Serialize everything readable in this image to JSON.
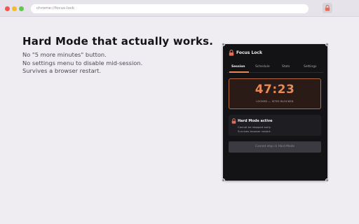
{
  "browser": {
    "url": "chrome://focus-lock",
    "window_controls": [
      "close",
      "minimize",
      "maximize"
    ],
    "extension_icon": "lock-icon"
  },
  "hero": {
    "headline": "Hard Mode that actually works.",
    "lines": [
      "No \"5 more minutes\" button.",
      "No settings menu to disable mid-session.",
      "Survives a browser restart."
    ]
  },
  "popup": {
    "title": "Focus Lock",
    "tabs": [
      {
        "label": "Session",
        "active": true
      },
      {
        "label": "Schedule",
        "active": false
      },
      {
        "label": "Stats",
        "active": false
      },
      {
        "label": "Settings",
        "active": false
      }
    ],
    "timer": {
      "value": "47:23",
      "status": "LOCKED — SITES BLOCKED"
    },
    "hard_mode": {
      "title": "Hard Mode active",
      "lines": [
        "Cannot be stopped early.",
        "Survives browser restart."
      ]
    },
    "stop_button_label": "Cannot stop in Hard Mode"
  },
  "colors": {
    "accent": "#e48a58",
    "popup_background": "#131315",
    "page_background": "#efedf2",
    "lock_icon": "#e86a57"
  }
}
